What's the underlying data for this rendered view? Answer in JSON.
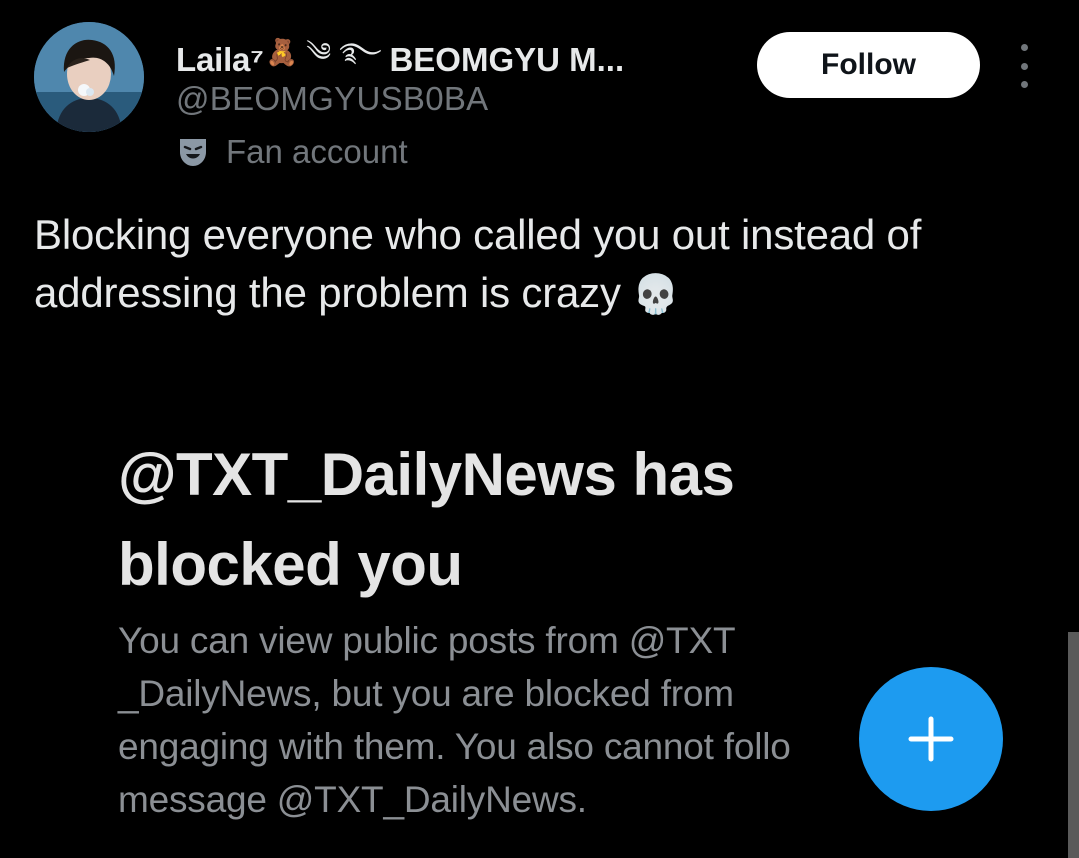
{
  "author": {
    "display_name": "Laila⁷",
    "name_emojis": "🧸 ༄ ࿐",
    "display_name_suffix": "BEOMGYU M...",
    "handle": "@BEOMGYUSB0BA",
    "account_label": "Fan account",
    "account_label_icon": "theater-mask-icon",
    "avatar_icon": "profile-photo"
  },
  "actions": {
    "follow_label": "Follow",
    "more_icon": "more-vertical-icon"
  },
  "post": {
    "text": "Blocking everyone who called you out instead of addressing the problem is crazy",
    "emoji": "💀"
  },
  "embedded_screenshot": {
    "title": "@TXT_DailyNews has blocked you",
    "description": "You can view public posts from @TXT _DailyNews, but you are blocked from engaging with them. You also cannot follo message @TXT_DailyNews."
  },
  "fab": {
    "icon": "plus-icon",
    "color": "#1d9bf0"
  },
  "colors": {
    "background": "#000000",
    "primary_text": "#e7e9ea",
    "secondary_text": "#71767b",
    "accent": "#1d9bf0"
  }
}
